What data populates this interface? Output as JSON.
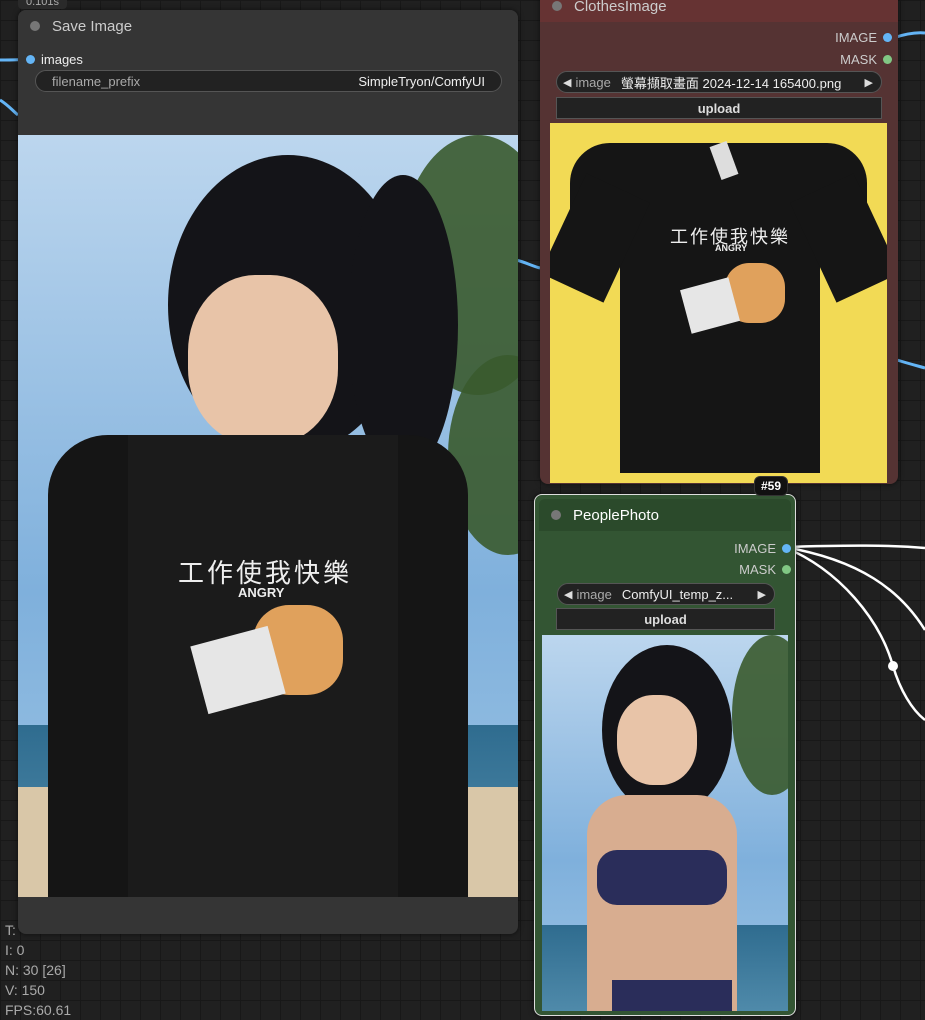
{
  "timing": "0.101s",
  "save_node": {
    "title": "Save Image",
    "input_label": "images",
    "widget_label": "filename_prefix",
    "widget_value": "SimpleTryon/ComfyUI"
  },
  "clothes_node": {
    "title": "ClothesImage",
    "output_image": "IMAGE",
    "output_mask": "MASK",
    "image_label": "image",
    "image_value": "螢幕擷取畫面 2024-12-14 165400.png",
    "upload_label": "upload",
    "shirt_text": "工作使我快樂",
    "shirt_subtext": "ANGRY"
  },
  "people_node": {
    "badge": "#59",
    "title": "PeoplePhoto",
    "output_image": "IMAGE",
    "output_mask": "MASK",
    "image_label": "image",
    "image_value": "ComfyUI_temp_z...",
    "upload_label": "upload"
  },
  "save_shirt": {
    "text": "工作使我快樂",
    "subtext": "ANGRY"
  },
  "stats": {
    "t": "T:",
    "i": "I: 0",
    "n": "N: 30 [26]",
    "v": "V: 150",
    "fps": "FPS:60.61"
  },
  "colors": {
    "image_port": "#64b5f6",
    "mask_port": "#81c784",
    "clothes_body": "#553333",
    "people_body": "#335533",
    "wire": "#64b5f6"
  },
  "icons": {
    "prev": "left-triangle-icon",
    "next": "right-triangle-icon"
  }
}
